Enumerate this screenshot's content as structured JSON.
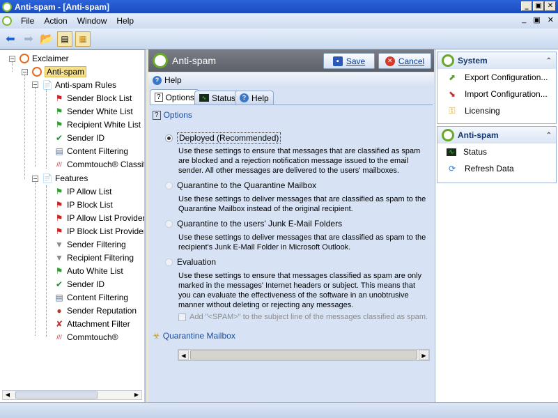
{
  "window": {
    "title": "Anti-spam - [Anti-spam]",
    "min": "_",
    "restore": "▣",
    "close": "✕"
  },
  "menu": {
    "items": [
      "File",
      "Action",
      "Window",
      "Help"
    ],
    "min": "_",
    "restore": "▣",
    "close": "✕"
  },
  "tree": {
    "root": "Exclaimer",
    "antispam": "Anti-spam",
    "rules_group": "Anti-spam Rules",
    "rules": [
      "Sender Block List",
      "Sender White List",
      "Recipient White List",
      "Sender ID",
      "Content Filtering",
      "Commtouch® Classific"
    ],
    "features_group": "Features",
    "features": [
      "IP Allow List",
      "IP Block List",
      "IP Allow List Providers",
      "IP Block List Providers",
      "Sender Filtering",
      "Recipient Filtering",
      "Auto White List",
      "Sender ID",
      "Content Filtering",
      "Sender Reputation",
      "Attachment Filter",
      "Commtouch®"
    ]
  },
  "center": {
    "title": "Anti-spam",
    "save": "Save",
    "cancel": "Cancel",
    "help": "Help",
    "tabs": [
      "Options",
      "Status",
      "Help"
    ],
    "section_options": "Options",
    "options": [
      {
        "label": "Deployed (Recommended)",
        "desc": "Use these settings to ensure that messages that are classified as spam are blocked and a rejection notification message issued to the email sender. All other messages are delivered to the users' mailboxes."
      },
      {
        "label": "Quarantine to the Quarantine Mailbox",
        "desc": "Use these settings to deliver messages that are classified as spam to the Quarantine Mailbox instead of the original recipient."
      },
      {
        "label": "Quarantine to the users' Junk E-Mail Folders",
        "desc": "Use these settings to deliver messages that are classified as spam to the recipient's Junk E-Mail Folder in Microsoft Outlook."
      },
      {
        "label": "Evaluation",
        "desc": "Use these settings to ensure that messages classified as spam are only marked in the messages' Internet headers or subject. This means that you can evaluate the effectiveness of the software in an unobtrusive manner without deleting or rejecting any messages."
      }
    ],
    "checkbox": "Add \"<SPAM>\" to the subject line of the messages classified as spam.",
    "section_quarantine": "Quarantine Mailbox"
  },
  "right": {
    "system": {
      "title": "System",
      "items": [
        "Export Configuration...",
        "Import Configuration...",
        "Licensing"
      ]
    },
    "antispam": {
      "title": "Anti-spam",
      "items": [
        "Status",
        "Refresh Data"
      ]
    }
  }
}
